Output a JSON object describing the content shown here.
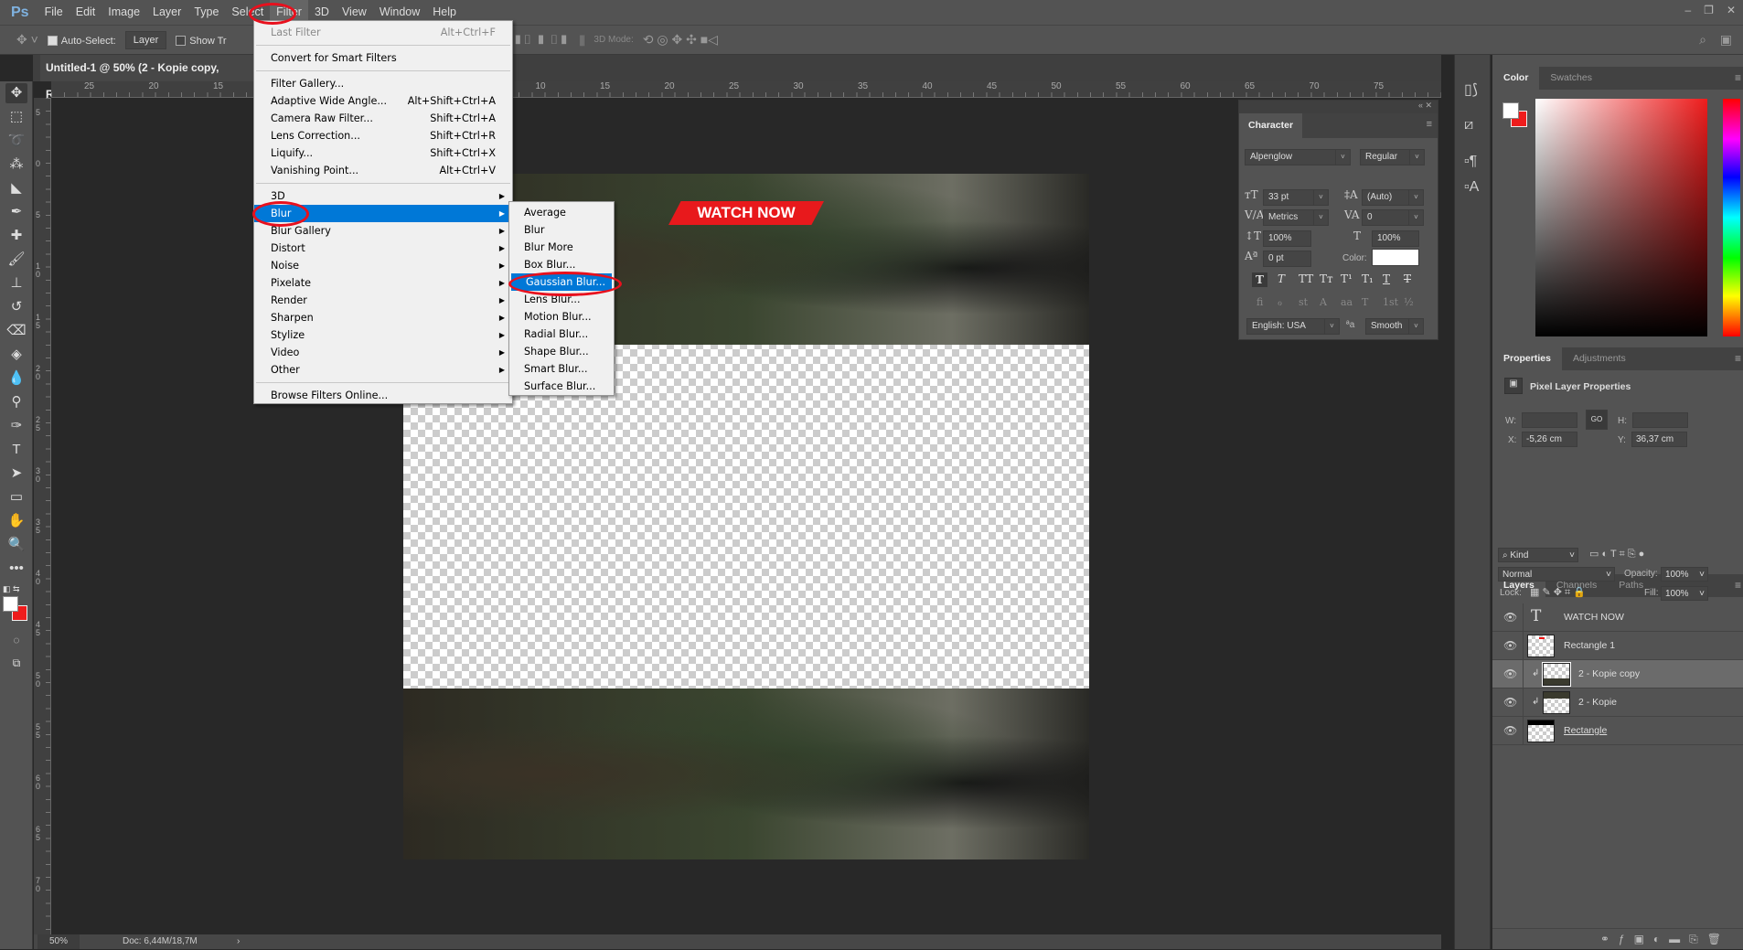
{
  "app": {
    "logo": "Ps",
    "window_controls": [
      "–",
      "❐",
      "✕"
    ]
  },
  "menubar": [
    "File",
    "Edit",
    "Image",
    "Layer",
    "Type",
    "Select",
    "Filter",
    "3D",
    "View",
    "Window",
    "Help"
  ],
  "options": {
    "auto_select_label": "Auto-Select:",
    "auto_select_checked": true,
    "target": "Layer",
    "show_transform": "Show Tr",
    "mode3d": "3D Mode:"
  },
  "document": {
    "tab_title": "Untitled-1 @ 50% (2 - Kopie copy, RGB/8#)",
    "zoom": "50%",
    "doc_size": "Doc: 6,44M/18,7M",
    "banner_text": "WATCH NOW"
  },
  "rulers": {
    "top": [
      "25",
      "20",
      "15",
      "10",
      "5",
      "0",
      "5",
      "10",
      "15",
      "20",
      "25",
      "30",
      "35",
      "40",
      "45",
      "50",
      "55",
      "60",
      "65",
      "70",
      "75"
    ],
    "left": [
      "5",
      "0",
      "5",
      "1 0",
      "1 5",
      "2 0",
      "2 5",
      "3 0",
      "3 5",
      "4 0",
      "4 5",
      "5 0",
      "5 5",
      "6 0",
      "6 5",
      "7 0"
    ]
  },
  "filter_menu": {
    "items": [
      {
        "label": "Last Filter",
        "shortcut": "Alt+Ctrl+F",
        "disabled": true
      },
      {
        "sep": true
      },
      {
        "label": "Convert for Smart Filters"
      },
      {
        "sep": true
      },
      {
        "label": "Filter Gallery..."
      },
      {
        "label": "Adaptive Wide Angle...",
        "shortcut": "Alt+Shift+Ctrl+A"
      },
      {
        "label": "Camera Raw Filter...",
        "shortcut": "Shift+Ctrl+A"
      },
      {
        "label": "Lens Correction...",
        "shortcut": "Shift+Ctrl+R"
      },
      {
        "label": "Liquify...",
        "shortcut": "Shift+Ctrl+X"
      },
      {
        "label": "Vanishing Point...",
        "shortcut": "Alt+Ctrl+V"
      },
      {
        "sep": true
      },
      {
        "label": "3D",
        "submenu": true
      },
      {
        "label": "Blur",
        "submenu": true,
        "highlighted": true
      },
      {
        "label": "Blur Gallery",
        "submenu": true
      },
      {
        "label": "Distort",
        "submenu": true
      },
      {
        "label": "Noise",
        "submenu": true
      },
      {
        "label": "Pixelate",
        "submenu": true
      },
      {
        "label": "Render",
        "submenu": true
      },
      {
        "label": "Sharpen",
        "submenu": true
      },
      {
        "label": "Stylize",
        "submenu": true
      },
      {
        "label": "Video",
        "submenu": true
      },
      {
        "label": "Other",
        "submenu": true
      },
      {
        "sep": true
      },
      {
        "label": "Browse Filters Online..."
      }
    ]
  },
  "blur_menu": {
    "items": [
      {
        "label": "Average"
      },
      {
        "label": "Blur"
      },
      {
        "label": "Blur More"
      },
      {
        "label": "Box Blur..."
      },
      {
        "label": "Gaussian Blur...",
        "highlighted": true
      },
      {
        "label": "Lens Blur..."
      },
      {
        "label": "Motion Blur..."
      },
      {
        "label": "Radial Blur..."
      },
      {
        "label": "Shape Blur..."
      },
      {
        "label": "Smart Blur..."
      },
      {
        "label": "Surface Blur..."
      }
    ]
  },
  "character": {
    "title": "Character",
    "font": "Alpenglow",
    "style": "Regular",
    "size": "33 pt",
    "leading": "(Auto)",
    "kerning": "Metrics",
    "tracking": "0",
    "vscale": "100%",
    "hscale": "100%",
    "baseline": "0 pt",
    "color_label": "Color:",
    "color": "#ffffff",
    "language": "English: USA",
    "antialias": "Smooth",
    "aa_icon": "ªa",
    "style_buttons": [
      "T",
      "T",
      "TT",
      "Tт",
      "T¹",
      "T₁",
      "T",
      "T"
    ],
    "opentype": [
      "ﬁ",
      "ℴ",
      "st",
      "A",
      "aa",
      "T",
      "1st",
      "½"
    ]
  },
  "color_panel": {
    "tabs": [
      "Color",
      "Swatches"
    ],
    "foreground": "#ffffff",
    "background": "#ee1c1c"
  },
  "properties": {
    "tabs": [
      "Properties",
      "Adjustments"
    ],
    "title": "Pixel Layer Properties",
    "w_label": "W:",
    "h_label": "H:",
    "x_label": "X:",
    "y_label": "Y:",
    "w": "",
    "h": "",
    "x": "-5,26 cm",
    "y": "36,37 cm",
    "link": "GO"
  },
  "layers": {
    "tabs": [
      "Layers",
      "Channels",
      "Paths"
    ],
    "filter": "Kind",
    "blend": "Normal",
    "opacity_label": "Opacity:",
    "opacity": "100%",
    "lock_label": "Lock:",
    "fill_label": "Fill:",
    "fill": "100%",
    "items": [
      {
        "name": "WATCH NOW",
        "type": "text"
      },
      {
        "name": "Rectangle 1",
        "type": "shape"
      },
      {
        "name": "2 - Kopie copy",
        "type": "pixel",
        "selected": true,
        "clipped": true
      },
      {
        "name": "2 - Kopie",
        "type": "pixel",
        "clipped": true
      },
      {
        "name": "Rectangle",
        "type": "shape"
      }
    ]
  },
  "accent": "#0078d7",
  "annotation_color": "#e8101d"
}
